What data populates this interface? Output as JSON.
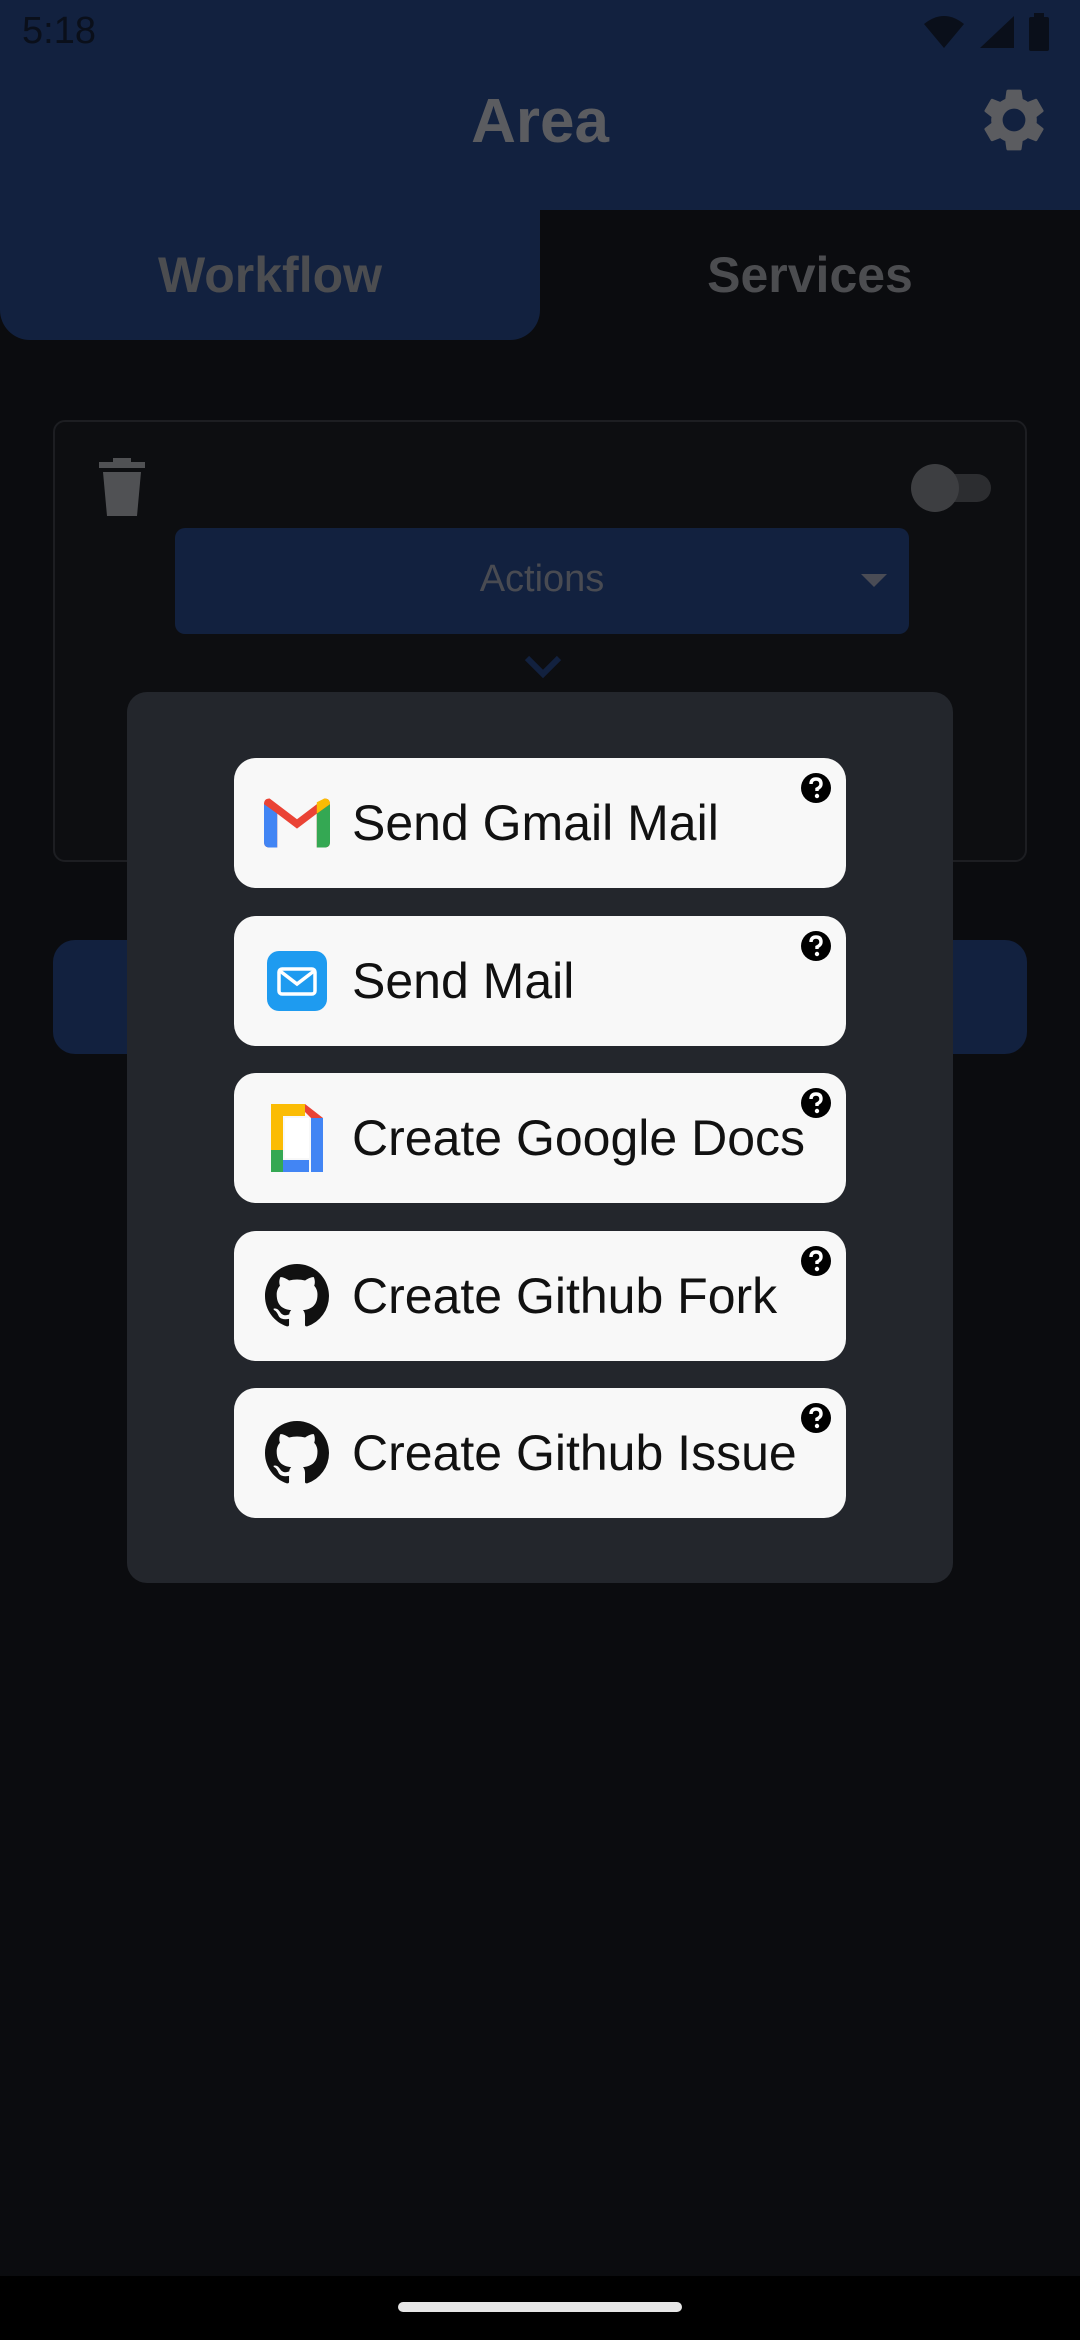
{
  "status_bar": {
    "time": "5:18",
    "icons": [
      "wifi-icon",
      "signal-icon",
      "battery-icon"
    ]
  },
  "app_bar": {
    "title": "Area",
    "settings_icon": "gear-icon"
  },
  "tabs": [
    {
      "label": "Workflow",
      "selected": true
    },
    {
      "label": "Services",
      "selected": false
    }
  ],
  "workflow_card": {
    "delete_icon": "trash-icon",
    "enabled": false,
    "actions_select": {
      "label": "Actions"
    },
    "expand_icon": "chevron-down-icon"
  },
  "dialog": {
    "options": [
      {
        "label": "Send Gmail Mail",
        "icon": "gmail-icon"
      },
      {
        "label": "Send Mail",
        "icon": "mail-app-icon"
      },
      {
        "label": "Create Google Docs",
        "icon": "google-docs-icon"
      },
      {
        "label": "Create Github Fork",
        "icon": "github-icon"
      },
      {
        "label": "Create Github Issue",
        "icon": "github-icon"
      }
    ],
    "help_icon": "help-circle-icon"
  },
  "colors": {
    "background": "#0b0c0f",
    "primary": "#12213f",
    "dialog": "#23262c",
    "option_background": "#f8f8f8"
  }
}
